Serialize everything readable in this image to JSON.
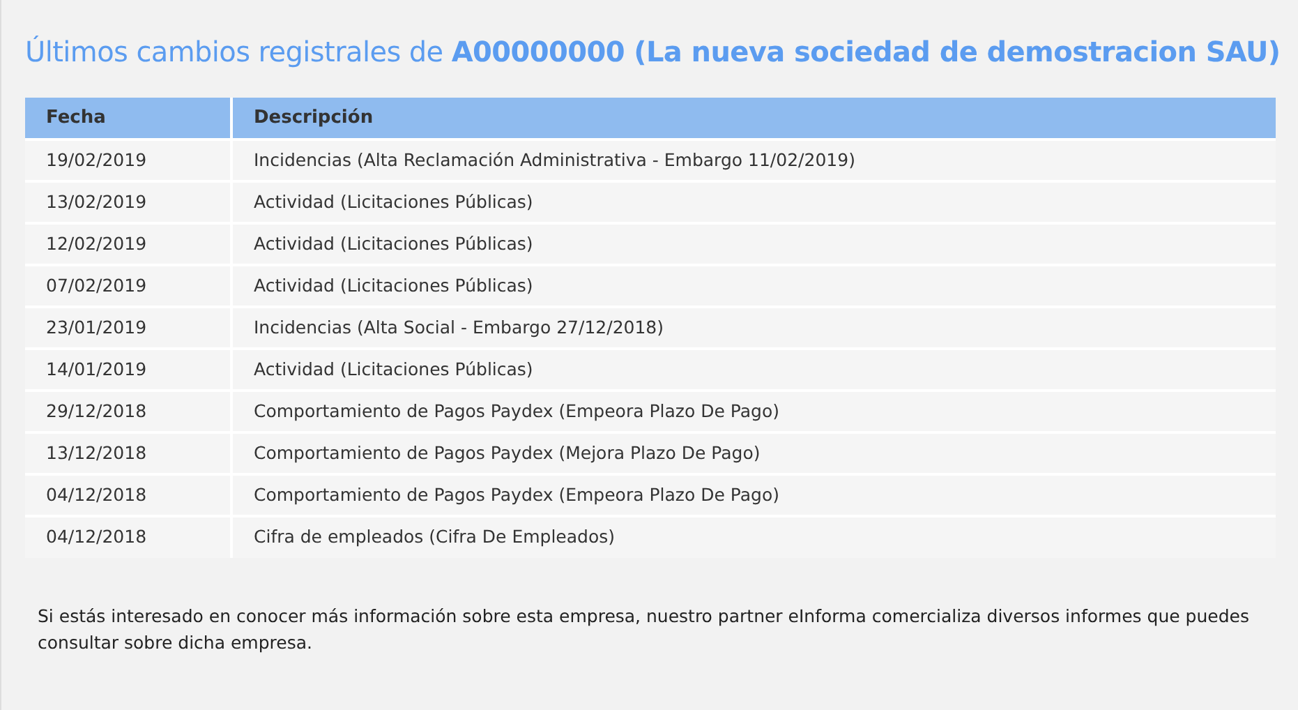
{
  "title": "Últimos cambios registrales de **A00000000 (La nueva sociedad de demostracion SAU)**",
  "table": {
    "columns": [
      "Fecha",
      "Descripción"
    ],
    "rows": [
      [
        "19/02/2019",
        "Incidencias (Alta Reclamación Administrativa - Embargo 11/02/2019)"
      ],
      [
        "13/02/2019",
        "Actividad (Licitaciones Públicas)"
      ],
      [
        "12/02/2019",
        "Actividad (Licitaciones Públicas)"
      ],
      [
        "07/02/2019",
        "Actividad (Licitaciones Públicas)"
      ],
      [
        "23/01/2019",
        "Incidencias (Alta Social - Embargo 27/12/2018)"
      ],
      [
        "14/01/2019",
        "Actividad (Licitaciones Públicas)"
      ],
      [
        "29/12/2018",
        "Comportamiento de Pagos Paydex (Empeora Plazo De Pago)"
      ],
      [
        "13/12/2018",
        "Comportamiento de Pagos Paydex (Mejora Plazo De Pago)"
      ],
      [
        "04/12/2018",
        "Comportamiento de Pagos Paydex (Empeora Plazo De Pago)"
      ],
      [
        "04/12/2018",
        "Cifra de empleados (Cifra De Empleados)"
      ]
    ]
  },
  "footer": "Si estás interesado en conocer más información sobre esta empresa, nuestro partner eInforma comercializa diversos informes que puedes consultar sobre dicha empresa."
}
